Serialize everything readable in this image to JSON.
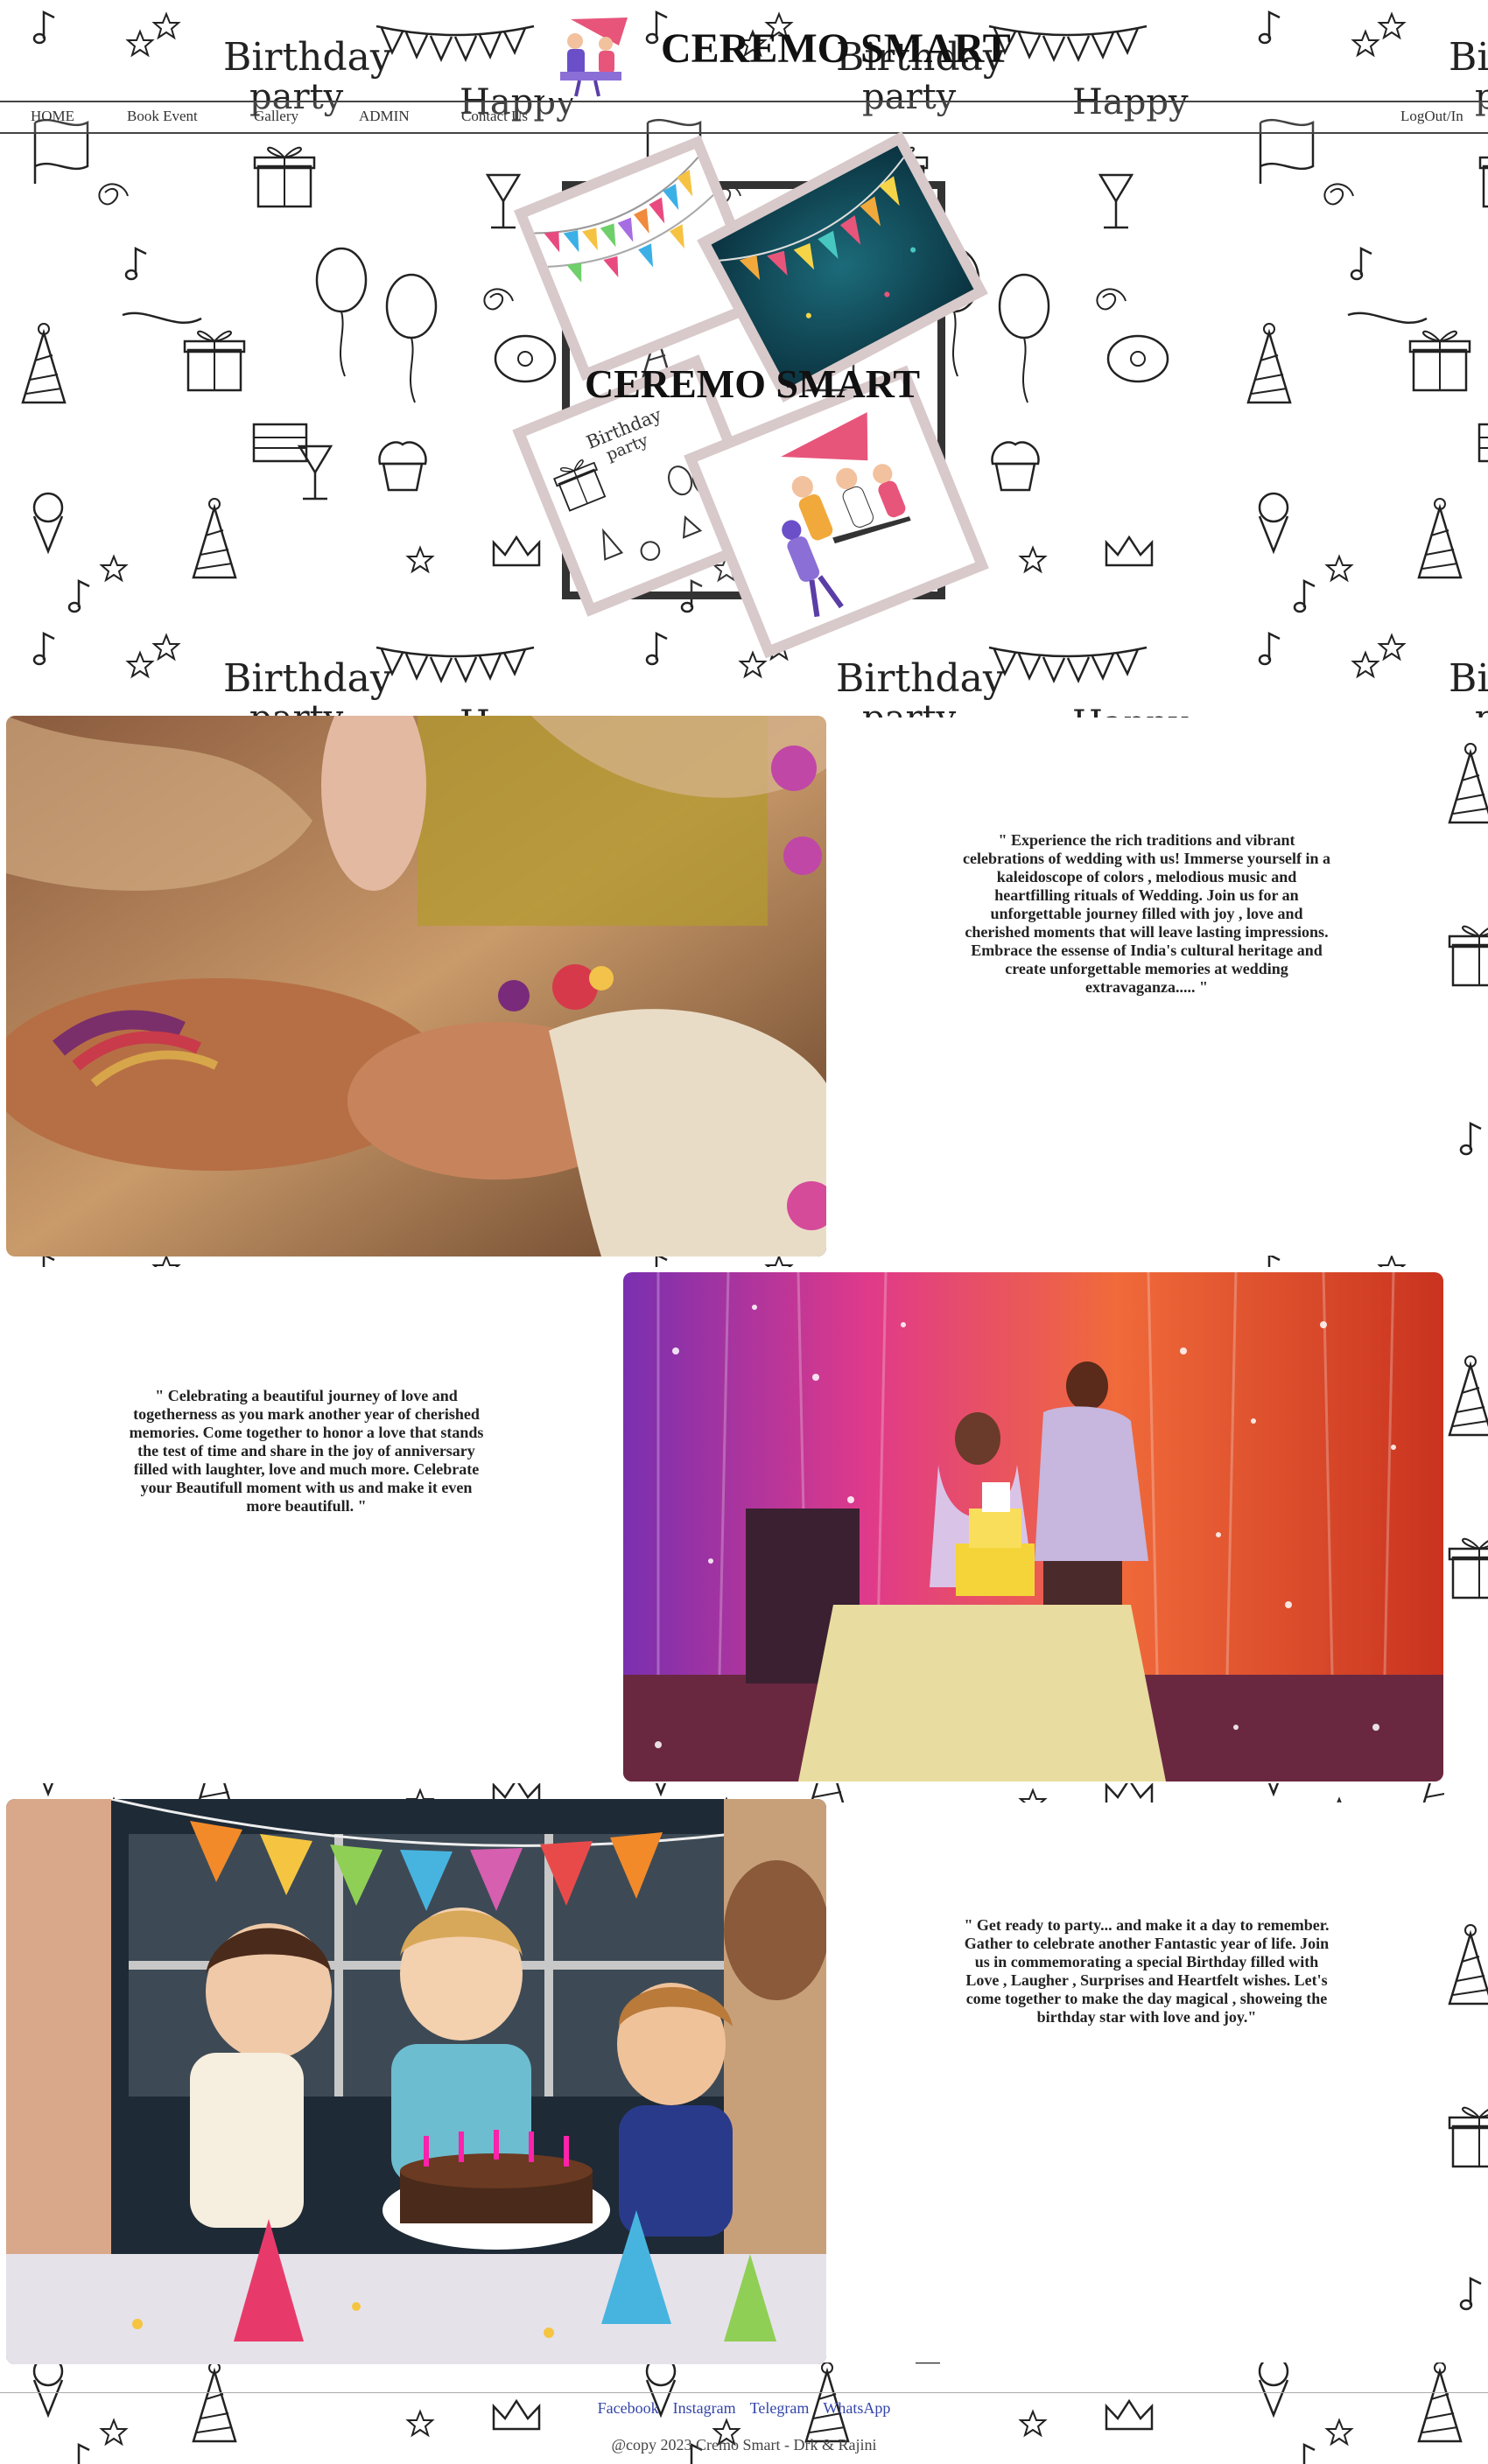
{
  "header": {
    "brand": "CEREMO SMART"
  },
  "nav": {
    "items": [
      {
        "label": "HOME"
      },
      {
        "label": "Book Event"
      },
      {
        "label": "Gallery"
      },
      {
        "label": "ADMIN"
      },
      {
        "label": "Contact Us"
      }
    ],
    "logout_label": "LogOut/In"
  },
  "hero": {
    "title": "CEREMO SMART"
  },
  "sections": [
    {
      "image": "wedding-hands-photo",
      "text": "\" Experience the rich traditions and vibrant celebrations of wedding with us! Immerse yourself in a kaleidoscope of colors , melodious music and heartfilling rituals of Wedding. Join us for an unforgettable journey filled with joy , love and cherished moments that will leave lasting impressions. Embrace the essense of India's cultural heritage and create unforgettable memories at wedding extravaganza..... \""
    },
    {
      "image": "anniversary-cake-photo",
      "text": "\" Celebrating a beautiful journey of love and togetherness as you mark another year of cherished memories. Come together to honor a love that stands the test of time and share in the joy of anniversary filled with laughter, love and much more. Celebrate your Beautifull moment with us and make it even more beautifull. \""
    },
    {
      "image": "birthday-kids-photo",
      "text": "\" Get ready to party... and make it a day to remember. Gather to celebrate another Fantastic year of life. Join us in commemorating a special Birthday filled with Love , Laugher , Surprises and Heartfelt wishes. Let's come together to make the day magical , showeing the birthday star with love and joy.\""
    }
  ],
  "doodle_text": {
    "birthday": "Birthday",
    "party": "party",
    "happy": "Happy"
  },
  "footer": {
    "links": [
      {
        "label": "Facebook"
      },
      {
        "label": "Instagram"
      },
      {
        "label": "Telegram"
      },
      {
        "label": "WhatsApp"
      }
    ],
    "copyright": "@copy 2023 Cremo Smart - Drk & Rajini"
  },
  "colors": {
    "link": "#3344aa",
    "nav_border": "#444444",
    "frame": "#333333",
    "photo_border": "#d8c9ca"
  }
}
